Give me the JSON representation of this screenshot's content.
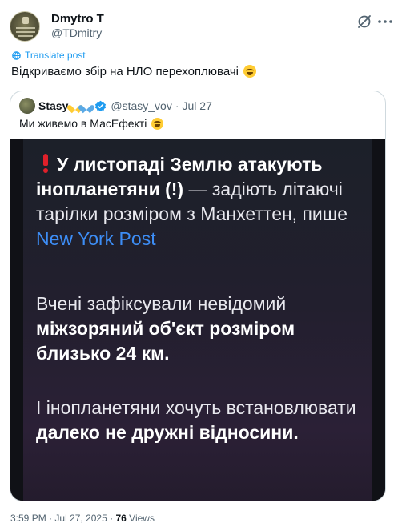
{
  "author": {
    "name": "Dmytro T",
    "handle": "@TDmitry",
    "avatar_icon": "avatar-crest-icon"
  },
  "actions": {
    "grok_icon": "grok-icon",
    "more_icon": "more-icon"
  },
  "translate_label": "Translate post",
  "tweet_text": "Відкриваємо збір на НЛО перехоплювачі",
  "quoted": {
    "name": "Stasy",
    "handle": "@stasy_vov",
    "separator": "·",
    "date": "Jul 27",
    "text": "Ми живемо в МасЕфекті",
    "media": {
      "paragraph1_bold": "У листопаді Землю атакують інопланетяни (!)",
      "paragraph1_rest": " — задіють літаючі тарілки розміром з Манхеттен, пише ",
      "paragraph1_link": "New York Post",
      "paragraph2_plain": "Вчені зафіксували невідомий ",
      "paragraph2_bold": "міжзоряний об'єкт розміром близько 24 км.",
      "paragraph3_plain": "І інопланетяни хочуть встановлювати ",
      "paragraph3_bold": "далеко не дружні відносини."
    }
  },
  "footer": {
    "time": "3:59 PM",
    "separator": "·",
    "date": "Jul 27, 2025",
    "separator2": "·",
    "views_count": "76",
    "views_label": "Views"
  },
  "colors": {
    "link": "#1d9bf0",
    "verified": "#1d9bf0",
    "media_link": "#3d8df5"
  }
}
